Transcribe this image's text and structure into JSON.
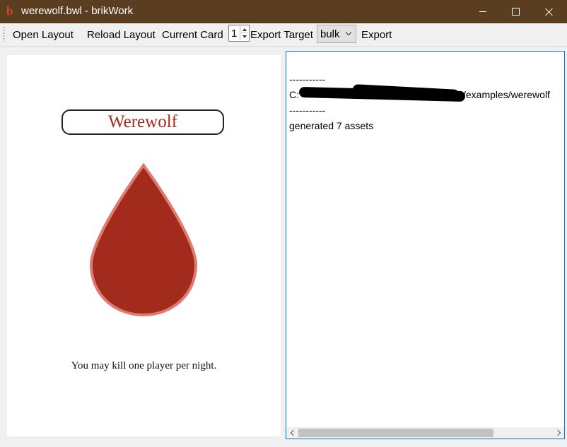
{
  "window": {
    "title": "werewolf.bwl - brikWork",
    "app_icon": "b",
    "titlebar_color": "#5b3d20"
  },
  "toolbar": {
    "open_layout": "Open Layout",
    "reload_layout": "Reload Layout",
    "current_card_label": "Current Card",
    "current_card_value": "1",
    "export_target_label": "Export Target",
    "export_target_value": "bulk",
    "export": "Export"
  },
  "card": {
    "title": "Werewolf",
    "text": "You may kill one player per night.",
    "title_color": "#a42b1d",
    "drop_fill": "#a22b1e",
    "drop_stroke": "#e07a70"
  },
  "log": {
    "separator_top": "-----------",
    "path_start": "C:",
    "path_end": "/examples/werewolf",
    "separator_bottom": "-----------",
    "status": "generated 7 assets"
  }
}
